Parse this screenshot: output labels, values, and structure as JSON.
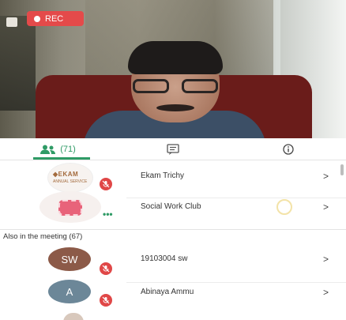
{
  "video": {
    "rec_label": "REC"
  },
  "tabs": [
    {
      "name": "participants",
      "label": "(71)",
      "icon": "people-icon",
      "active": true
    },
    {
      "name": "chat",
      "label": "",
      "icon": "chat-icon",
      "active": false
    },
    {
      "name": "info",
      "label": "",
      "icon": "info-icon",
      "active": false
    }
  ],
  "pinned_participants": [
    {
      "name": "Ekam Trichy",
      "avatar": "ekam-logo",
      "logo_text": "◆EKAM",
      "logo_sub": "ANNUAL SERVICE",
      "status_icon": "mic-muted-icon"
    },
    {
      "name": "Social Work Club",
      "avatar": "club-badge",
      "status_icon": "more-dots-icon"
    }
  ],
  "section": {
    "label": "Also in the meeting (67)"
  },
  "participants": [
    {
      "name": "19103004 sw",
      "initials": "SW",
      "avatar_color": "#8c5a48",
      "status_icon": "mic-muted-icon"
    },
    {
      "name": "Abinaya Ammu",
      "initials": "A",
      "avatar_color": "#6c8798",
      "status_icon": "mic-muted-icon"
    }
  ],
  "chevron": ">",
  "more_dots": "•••",
  "colors": {
    "accent": "#2f9b66",
    "rec": "#e44a4a",
    "muted_badge": "#e04747"
  }
}
